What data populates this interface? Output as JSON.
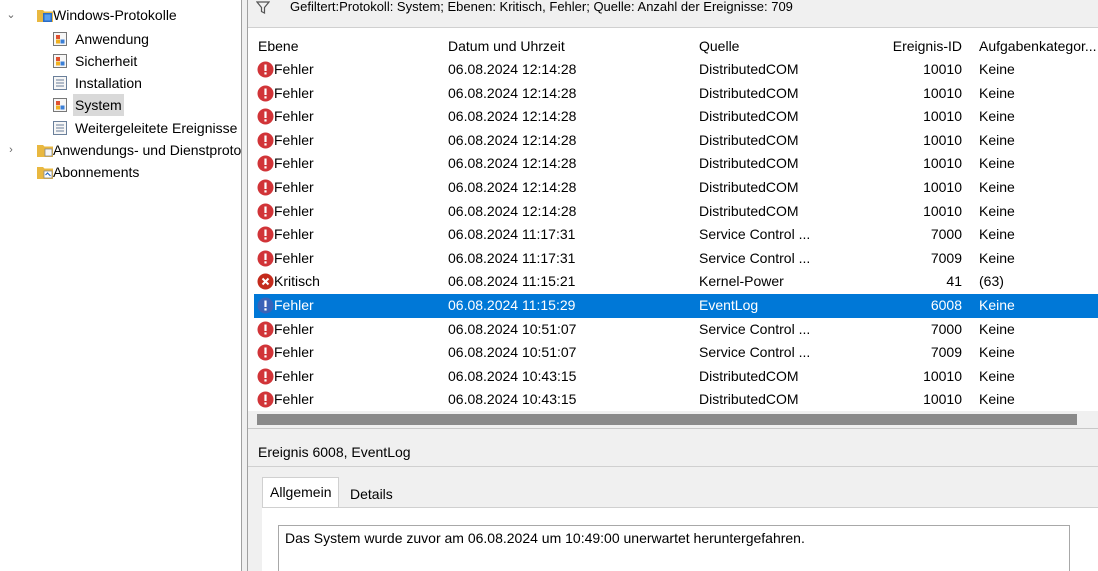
{
  "tree": {
    "items": [
      {
        "label": "Windows-Protokolle",
        "expander": "⌄",
        "icon": "folder-logs-icon",
        "indent": 0,
        "selected": false
      },
      {
        "label": "Anwendung",
        "expander": "",
        "icon": "log-icon",
        "indent": 1,
        "selected": false
      },
      {
        "label": "Sicherheit",
        "expander": "",
        "icon": "log-icon",
        "indent": 1,
        "selected": false
      },
      {
        "label": "Installation",
        "expander": "",
        "icon": "log-plain-icon",
        "indent": 1,
        "selected": false
      },
      {
        "label": "System",
        "expander": "",
        "icon": "log-icon",
        "indent": 1,
        "selected": true
      },
      {
        "label": "Weitergeleitete Ereignisse",
        "expander": "",
        "icon": "log-plain-icon",
        "indent": 1,
        "selected": false
      },
      {
        "label": "Anwendungs- und Dienstprotokolle",
        "expander": "›",
        "icon": "folder-icon",
        "indent": 0,
        "selected": false
      },
      {
        "label": "Abonnements",
        "expander": "",
        "icon": "subscriptions-icon",
        "indent": 0,
        "selected": false
      }
    ]
  },
  "filter": {
    "text": "Gefiltert:Protokoll: System; Ebenen: Kritisch, Fehler; Quelle:  Anzahl der Ereignisse: 709"
  },
  "grid": {
    "columns": {
      "level": "Ebene",
      "date": "Datum und Uhrzeit",
      "source": "Quelle",
      "id": "Ereignis-ID",
      "task": "Aufgabenkategor..."
    },
    "rows": [
      {
        "level": "Fehler",
        "kind": "error",
        "date": "06.08.2024 12:14:28",
        "source": "DistributedCOM",
        "id": "10010",
        "task": "Keine",
        "selected": false
      },
      {
        "level": "Fehler",
        "kind": "error",
        "date": "06.08.2024 12:14:28",
        "source": "DistributedCOM",
        "id": "10010",
        "task": "Keine",
        "selected": false
      },
      {
        "level": "Fehler",
        "kind": "error",
        "date": "06.08.2024 12:14:28",
        "source": "DistributedCOM",
        "id": "10010",
        "task": "Keine",
        "selected": false
      },
      {
        "level": "Fehler",
        "kind": "error",
        "date": "06.08.2024 12:14:28",
        "source": "DistributedCOM",
        "id": "10010",
        "task": "Keine",
        "selected": false
      },
      {
        "level": "Fehler",
        "kind": "error",
        "date": "06.08.2024 12:14:28",
        "source": "DistributedCOM",
        "id": "10010",
        "task": "Keine",
        "selected": false
      },
      {
        "level": "Fehler",
        "kind": "error",
        "date": "06.08.2024 12:14:28",
        "source": "DistributedCOM",
        "id": "10010",
        "task": "Keine",
        "selected": false
      },
      {
        "level": "Fehler",
        "kind": "error",
        "date": "06.08.2024 12:14:28",
        "source": "DistributedCOM",
        "id": "10010",
        "task": "Keine",
        "selected": false
      },
      {
        "level": "Fehler",
        "kind": "error",
        "date": "06.08.2024 11:17:31",
        "source": "Service Control ...",
        "id": "7000",
        "task": "Keine",
        "selected": false
      },
      {
        "level": "Fehler",
        "kind": "error",
        "date": "06.08.2024 11:17:31",
        "source": "Service Control ...",
        "id": "7009",
        "task": "Keine",
        "selected": false
      },
      {
        "level": "Kritisch",
        "kind": "critical",
        "date": "06.08.2024 11:15:21",
        "source": "Kernel-Power",
        "id": "41",
        "task": "(63)",
        "selected": false
      },
      {
        "level": "Fehler",
        "kind": "error",
        "date": "06.08.2024 11:15:29",
        "source": "EventLog",
        "id": "6008",
        "task": "Keine",
        "selected": true
      },
      {
        "level": "Fehler",
        "kind": "error",
        "date": "06.08.2024 10:51:07",
        "source": "Service Control ...",
        "id": "7000",
        "task": "Keine",
        "selected": false
      },
      {
        "level": "Fehler",
        "kind": "error",
        "date": "06.08.2024 10:51:07",
        "source": "Service Control ...",
        "id": "7009",
        "task": "Keine",
        "selected": false
      },
      {
        "level": "Fehler",
        "kind": "error",
        "date": "06.08.2024 10:43:15",
        "source": "DistributedCOM",
        "id": "10010",
        "task": "Keine",
        "selected": false
      },
      {
        "level": "Fehler",
        "kind": "error",
        "date": "06.08.2024 10:43:15",
        "source": "DistributedCOM",
        "id": "10010",
        "task": "Keine",
        "selected": false
      }
    ]
  },
  "detail": {
    "title": "Ereignis 6008, EventLog",
    "tabs": [
      "Allgemein",
      "Details"
    ],
    "message": "Das System wurde zuvor am 06.08.2024 um 10:49:00 unerwartet heruntergefahren."
  },
  "colors": {
    "selection": "#0078d7",
    "error": "#d13438",
    "critical": "#c42b1c",
    "selected_error": "#3a63b8"
  }
}
